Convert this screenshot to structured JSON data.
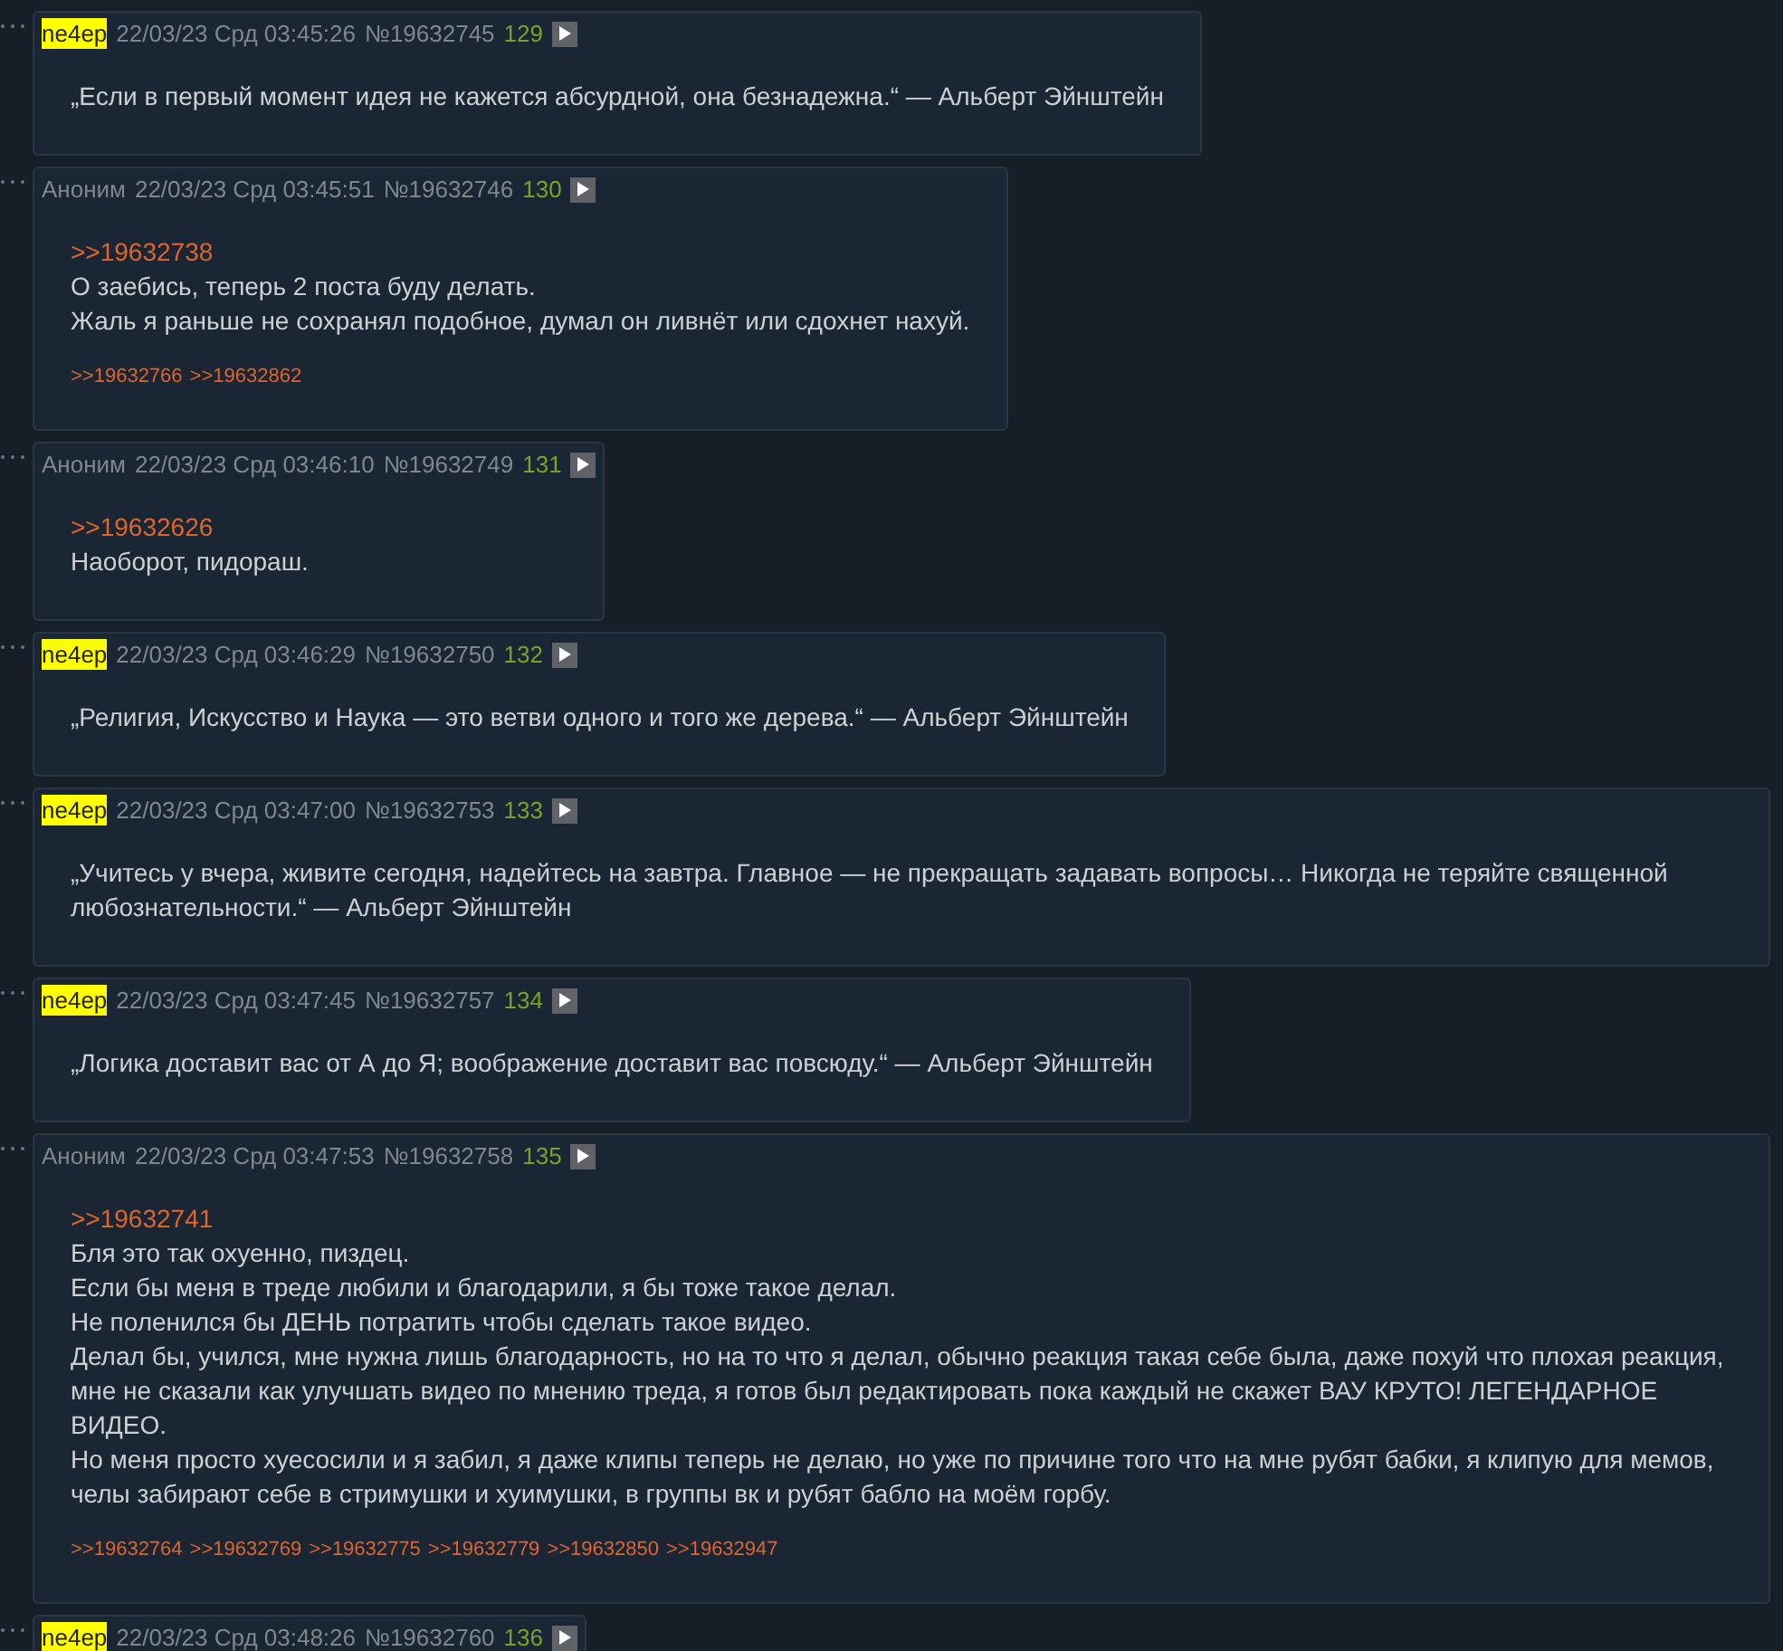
{
  "posts": [
    {
      "name": "ne4ep",
      "highlighted": true,
      "date": "22/03/23 Срд 03:45:26",
      "number": "№19632745",
      "count": "129",
      "lines": [
        "„Если в первый момент идея не кажется абсурдной, она безнадежна.“ — Альберт Эйнштейн"
      ]
    },
    {
      "name": "Аноним",
      "highlighted": false,
      "date": "22/03/23 Срд 03:45:51",
      "number": "№19632746",
      "count": "130",
      "reply_to": ">>19632738",
      "lines": [
        "О заебись, теперь 2 поста буду делать.",
        "Жаль я раньше не сохранял подобное, думал он ливнёт или сдохнет нахуй."
      ],
      "replies": [
        ">>19632766",
        ">>19632862"
      ]
    },
    {
      "name": "Аноним",
      "highlighted": false,
      "date": "22/03/23 Срд 03:46:10",
      "number": "№19632749",
      "count": "131",
      "reply_to": ">>19632626",
      "lines": [
        "Наоборот, пидораш."
      ]
    },
    {
      "name": "ne4ep",
      "highlighted": true,
      "date": "22/03/23 Срд 03:46:29",
      "number": "№19632750",
      "count": "132",
      "lines": [
        "„Религия, Искусство и Наука — это ветви одного и того же дерева.“ — Альберт Эйнштейн"
      ]
    },
    {
      "name": "ne4ep",
      "highlighted": true,
      "date": "22/03/23 Срд 03:47:00",
      "number": "№19632753",
      "count": "133",
      "lines": [
        "„Учитесь у вчера, живите сегодня, надейтесь на завтра. Главное — не прекращать задавать вопросы… Никогда не теряйте священной любознательности.“ — Альберт Эйнштейн"
      ]
    },
    {
      "name": "ne4ep",
      "highlighted": true,
      "date": "22/03/23 Срд 03:47:45",
      "number": "№19632757",
      "count": "134",
      "lines": [
        "„Логика доставит вас от А до Я; воображение доставит вас повсюду.“ — Альберт Эйнштейн"
      ]
    },
    {
      "name": "Аноним",
      "highlighted": false,
      "date": "22/03/23 Срд 03:47:53",
      "number": "№19632758",
      "count": "135",
      "reply_to": ">>19632741",
      "lines": [
        "Бля это так охуенно, пиздец.",
        "Если бы меня в треде любили и благодарили, я бы тоже такое делал.",
        "Не поленился бы ДЕНЬ потратить чтобы сделать такое видео.",
        "Делал бы, учился, мне нужна лишь благодарность, но на то что я делал, обычно реакция такая себе была, даже похуй что плохая реакция, мне не сказали как улучшать видео по мнению треда, я готов был редактировать пока каждый не скажет ВАУ КРУТО! ЛЕГЕНДАРНОЕ ВИДЕО.",
        "Но меня просто хуесосили и я забил, я даже клипы теперь не делаю, но уже по причине того что на мне рубят бабки, я клипую для мемов, челы забирают себе в стримушки и хуимушки, в группы вк и рубят бабло на моём горбу."
      ],
      "replies": [
        ">>19632764",
        ">>19632769",
        ">>19632775",
        ">>19632779",
        ">>19632850",
        ">>19632947"
      ]
    },
    {
      "name": "ne4ep",
      "highlighted": true,
      "date": "22/03/23 Срд 03:48:26",
      "number": "№19632760",
      "count": "136"
    }
  ]
}
